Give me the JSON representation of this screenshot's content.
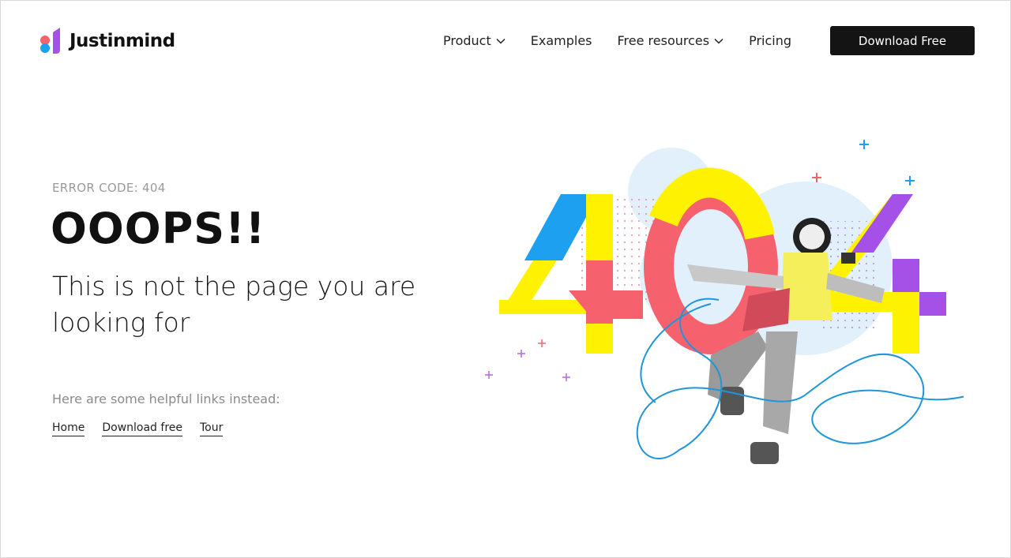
{
  "header": {
    "brand": "Justinmind",
    "nav": [
      {
        "label": "Product",
        "has_dropdown": true
      },
      {
        "label": "Examples",
        "has_dropdown": false
      },
      {
        "label": "Free resources",
        "has_dropdown": true
      },
      {
        "label": "Pricing",
        "has_dropdown": false
      }
    ],
    "cta_label": "Download Free"
  },
  "main": {
    "error_code": "ERROR CODE: 404",
    "headline": "OOOPS!!",
    "subline": "This is not the page you are looking for",
    "helpful_text": "Here are some helpful links instead:",
    "links": [
      {
        "label": "Home"
      },
      {
        "label": "Download free"
      },
      {
        "label": "Tour"
      }
    ]
  },
  "illustration": {
    "digits": [
      "4",
      "0",
      "4"
    ]
  },
  "colors": {
    "yellow": "#FFF200",
    "pink": "#F5626E",
    "blue": "#1EA0F0",
    "purple": "#A551E8",
    "cloud": "#E1F0FB",
    "line": "#1E96D8",
    "dark": "#141414"
  },
  "icons": {
    "logo": "justinmind-logo-icon",
    "dropdown": "chevron-down-icon",
    "plus": "plus-icon"
  }
}
